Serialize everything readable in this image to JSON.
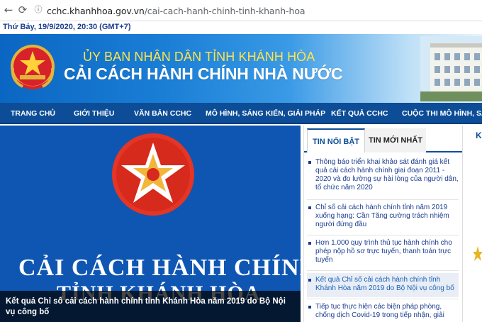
{
  "browser": {
    "domain": "cchc.khanhhoa.gov.vn",
    "path": "/cai-cach-hanh-chinh-tinh-khanh-hoa"
  },
  "date_text": "Thứ Bảy, 19/9/2020, 20:30 (GMT+7)",
  "banner": {
    "line1": "ỦY BAN NHÂN DÂN TỈNH KHÁNH HÒA",
    "line2": "CẢI CÁCH HÀNH CHÍNH NHÀ NƯỚC"
  },
  "nav": [
    "TRANG CHỦ",
    "GIỚI THIỆU",
    "VĂN BẢN CCHC",
    "MÔ HÌNH, SÁNG KIẾN, GIẢI PHÁP",
    "KẾT QUẢ CCHC",
    "CUỘC THI MÔ HÌNH, SÁNG"
  ],
  "hero": {
    "big_line1": "CẢI CÁCH HÀNH CHÍNH",
    "big_line2": "TỈNH KHÁNH HÒA",
    "caption": "Kết quả Chỉ số cải cách hành chính tỉnh Khánh Hòa năm 2019 do Bộ Nội vụ công bố"
  },
  "tabs": [
    "TIN NỔI BẬT",
    "TIN MỚI NHẤT"
  ],
  "news": [
    "Thông báo triển khai khảo sát đánh giá kết quả cải cách hành chính giai đoạn 2011 - 2020 và đo lường sự hài lòng của người dân, tổ chức năm 2020",
    "Chỉ số cải cách hành chính tỉnh năm 2019 xuống hạng: Cần Tăng cường trách nhiệm người đứng đầu",
    "Hơn 1.000 quy trình thủ tục hành chính cho phép nộp hồ sơ trực tuyến, thanh toán trực tuyến",
    "Kết quả Chỉ số cải cách hành chính tỉnh Khánh Hòa năm 2019 do Bộ Nội vụ công bố",
    "Tiếp tục thực hiện các biện pháp phòng, chống dịch Covid-19 trong tiếp nhận, giải"
  ],
  "right_edge_letter": "K",
  "colors": {
    "nav_bg": "#0d4d97",
    "banner_yellow": "#ffe34a",
    "link_blue": "#1a3c8f",
    "hero_bg": "#0f56b3"
  }
}
